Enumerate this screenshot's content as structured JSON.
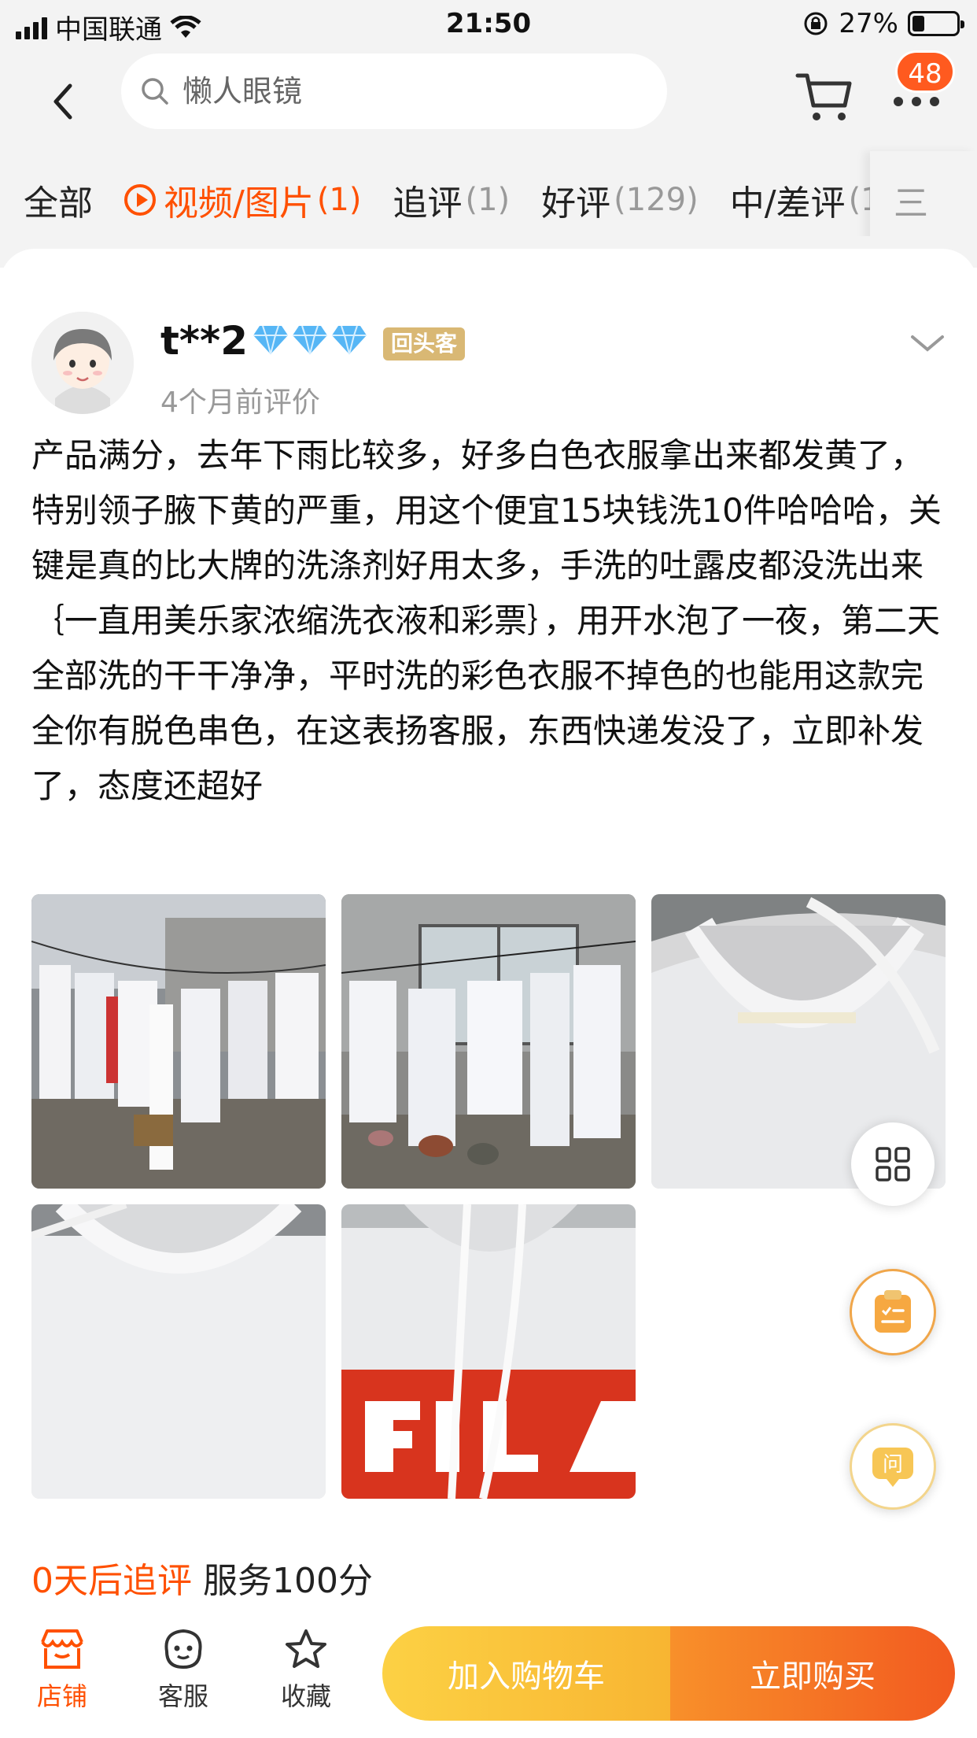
{
  "status_bar": {
    "carrier": "中国联通",
    "time": "21:50",
    "battery": "27%",
    "battery_level": 0.27
  },
  "nav": {
    "search_placeholder": "懒人眼镜",
    "cart_badge": "48"
  },
  "tabs": [
    {
      "label": "全部",
      "count": ""
    },
    {
      "label": "视频/图片",
      "count": "(1)"
    },
    {
      "label": "追评",
      "count": "(1)"
    },
    {
      "label": "好评",
      "count": "(129)"
    },
    {
      "label": "中/差评",
      "count": "(1"
    }
  ],
  "tabs_menu": "三",
  "review": {
    "username": "t**2",
    "badge": "回头客",
    "time": "4个月前评价",
    "text": "产品满分，去年下雨比较多，好多白色衣服拿出来都发黄了，特别领子腋下黄的严重，用这个便宜15块钱洗10件哈哈哈，关键是真的比大牌的洗涤剂好用太多，手洗的吐露皮都没洗出来｛一直用美乐家浓缩洗衣液和彩票｝，用开水泡了一夜，第二天全部洗的干干净净，平时洗的彩色衣服不掉色的也能用这款完全你有脱色串色，在这表扬客服，东西快递发没了，立即补发了，态度还超好",
    "follow_up": "0天后追评",
    "service": "服务100分"
  },
  "float_buttons": {
    "ask": "问"
  },
  "bottom_bar": {
    "shop": "店铺",
    "service": "客服",
    "favorite": "收藏",
    "add_to_cart": "加入购物车",
    "buy_now": "立即购买"
  },
  "colors": {
    "accent": "#ff5000",
    "badge_gold": "#d9b874",
    "cart_yellow": "#fcd144",
    "buy_orange": "#f25a20"
  }
}
